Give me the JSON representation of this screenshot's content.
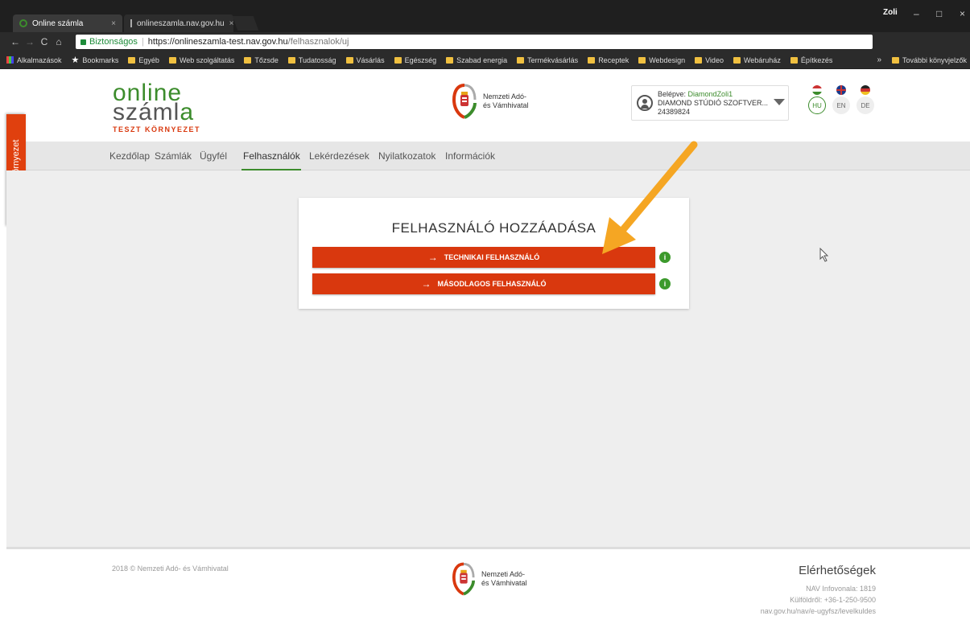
{
  "browser": {
    "tabs": [
      {
        "title": "Online számla",
        "close": "×"
      },
      {
        "title": "onlineszamla.nav.gov.hu",
        "close": "×"
      }
    ],
    "profile_name": "Zoli",
    "window_controls": {
      "minimize": "–",
      "maximize": "□",
      "close": "×"
    },
    "nav": {
      "back": "←",
      "forward": "→",
      "reload": "C",
      "home": "⌂"
    },
    "url": {
      "secure_label": "Biztonságos",
      "separator": "|",
      "base": "https://onlineszamla-test.nav.gov.hu",
      "path": "/felhasznalok/uj"
    },
    "bookmarks": [
      {
        "label": "Alkalmazások",
        "icon": "apps-icon"
      },
      {
        "label": "Bookmarks",
        "icon": "star-icon"
      },
      {
        "label": "Egyéb",
        "icon": "folder-icon"
      },
      {
        "label": "Web szolgáltatás",
        "icon": "folder-icon"
      },
      {
        "label": "Tőzsde",
        "icon": "folder-icon"
      },
      {
        "label": "Tudatosság",
        "icon": "folder-icon"
      },
      {
        "label": "Vásárlás",
        "icon": "folder-icon"
      },
      {
        "label": "Egészség",
        "icon": "folder-icon"
      },
      {
        "label": "Szabad energia",
        "icon": "folder-icon"
      },
      {
        "label": "Termékvásárlás",
        "icon": "folder-icon"
      },
      {
        "label": "Receptek",
        "icon": "folder-icon"
      },
      {
        "label": "Webdesign",
        "icon": "folder-icon"
      },
      {
        "label": "Video",
        "icon": "folder-icon"
      },
      {
        "label": "Webáruház",
        "icon": "folder-icon"
      },
      {
        "label": "Építkezés",
        "icon": "folder-icon"
      }
    ],
    "bookmarks_more": "»",
    "other_bookmarks": "További könyvjelzők"
  },
  "header": {
    "logo_line1": "online",
    "logo_line2_a": "száml",
    "logo_line2_b": "a",
    "logo_sub": "TESZT KÖRNYEZET",
    "nav_name_line1": "Nemzeti Adó-",
    "nav_name_line2": "és Vámhivatal",
    "user": {
      "logged_in_label": "Belépve:",
      "username": "DiamondZoli1",
      "company": "DIAMOND STÚDIÓ SZOFTVER...",
      "tax_number": "24389824"
    },
    "languages": [
      {
        "code": "HU",
        "active": true
      },
      {
        "code": "EN",
        "active": false
      },
      {
        "code": "DE",
        "active": false
      }
    ]
  },
  "menu": [
    "Kezdőlap",
    "Számlák",
    "Ügyfél",
    "Felhasználók",
    "Lekérdezések",
    "Nyilatkozatok",
    "Információk"
  ],
  "side_tab": "Teszt környezet",
  "card": {
    "title": "FELHASZNÁLÓ HOZZÁADÁSA",
    "buttons": [
      {
        "label": "TECHNIKAI FELHASZNÁLÓ",
        "arrow": "→",
        "info": "i"
      },
      {
        "label": "MÁSODLAGOS FELHASZNÁLÓ",
        "arrow": "→",
        "info": "i"
      }
    ]
  },
  "footer": {
    "copyright": "2018 © Nemzeti Adó- és Vámhivatal",
    "nav_name_line1": "Nemzeti Adó-",
    "nav_name_line2": "és Vámhivatal",
    "contacts_title": "Elérhetőségek",
    "contacts": [
      "NAV Infovonala: 1819",
      "Külföldről: +36-1-250-9500",
      "nav.gov.hu/nav/e-ugyfsz/levelkuldes"
    ]
  },
  "colors": {
    "accent_orange": "#d9380e",
    "brand_green": "#3c8c2c",
    "annotation_arrow": "#f5a623"
  }
}
